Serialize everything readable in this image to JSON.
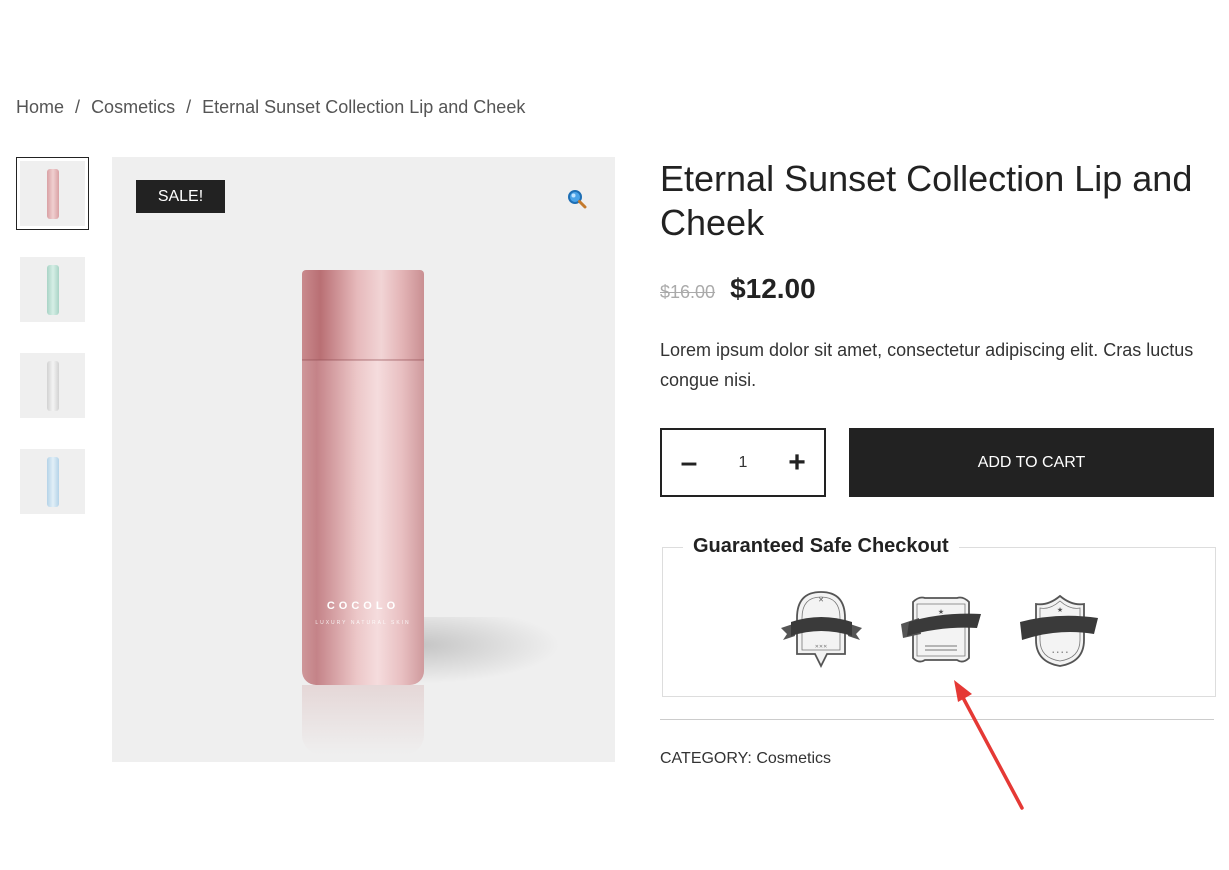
{
  "breadcrumb": {
    "items": [
      "Home",
      "Cosmetics",
      "Eternal Sunset Collection Lip and Cheek"
    ],
    "separator": "/"
  },
  "gallery": {
    "thumbnails": [
      {
        "name": "pink-bottle-thumb",
        "color": "#e7b6b8",
        "active": true
      },
      {
        "name": "mint-bottle-thumb",
        "color": "#bfe0d6",
        "active": false
      },
      {
        "name": "white-bottle-thumb",
        "color": "#e2e2e2",
        "active": false
      },
      {
        "name": "blue-bottle-thumb",
        "color": "#c9e0ef",
        "active": false
      }
    ],
    "sale_label": "SALE!",
    "zoom_icon": "magnifier-icon",
    "product_brand": "COCOLO",
    "product_brand_sub": "LUXURY NATURAL SKIN"
  },
  "product": {
    "title": "Eternal Sunset Collection Lip and Cheek",
    "old_price": "$16.00",
    "price": "$12.00",
    "description": "Lorem ipsum dolor sit amet, consectetur adipiscing elit. Cras luctus congue nisi.",
    "quantity": "1",
    "add_to_cart_label": "ADD TO CART",
    "category_label": "CATEGORY:",
    "category_value": "Cosmetics"
  },
  "checkout": {
    "title": "Guaranteed Safe Checkout",
    "badges": [
      "shield-ribbon-badge-icon",
      "frame-ribbon-badge-icon",
      "crest-ribbon-badge-icon"
    ]
  },
  "colors": {
    "accent_dark": "#222222",
    "annotation_arrow": "#e53935"
  }
}
